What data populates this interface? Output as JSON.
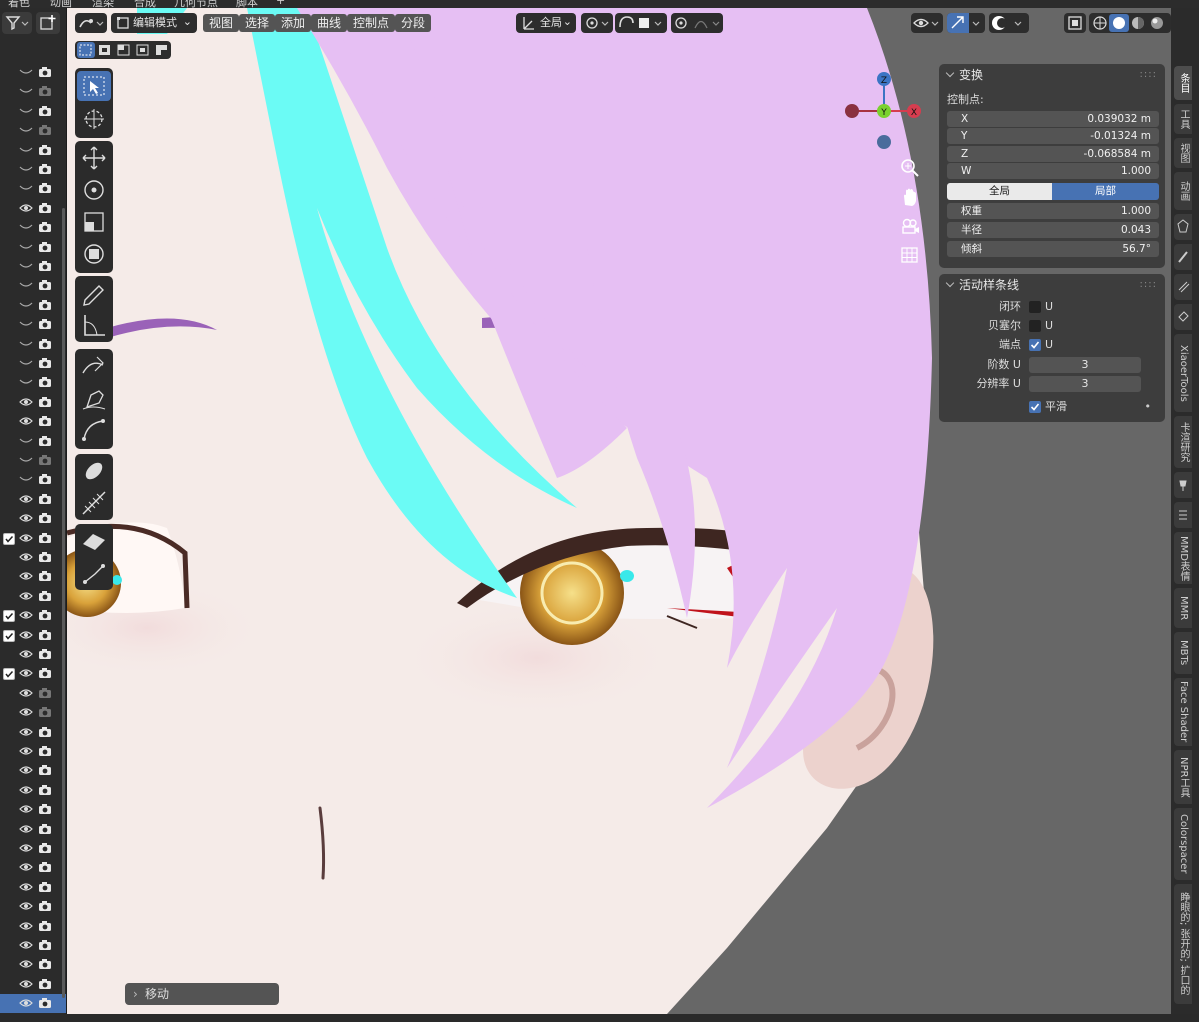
{
  "top_tabs": [
    "着色",
    "动画",
    "渲染",
    "合成",
    "几何节点",
    "脚本",
    "+"
  ],
  "header": {
    "mode": "编辑模式",
    "menus": [
      "视图",
      "选择",
      "添加",
      "曲线",
      "控制点",
      "分段"
    ],
    "orientation": "全局"
  },
  "transform_panel": {
    "title": "变换",
    "control_point_label": "控制点:",
    "fields": [
      {
        "label": "X",
        "value": "0.039032 m"
      },
      {
        "label": "Y",
        "value": "-0.01324 m"
      },
      {
        "label": "Z",
        "value": "-0.068584 m"
      },
      {
        "label": "W",
        "value": "1.000"
      }
    ],
    "space_global": "全局",
    "space_local": "局部",
    "space_active": "局部",
    "extra": [
      {
        "label": "权重",
        "value": "1.000"
      },
      {
        "label": "半径",
        "value": "0.043"
      },
      {
        "label": "倾斜",
        "value": "56.7°"
      }
    ]
  },
  "spline_panel": {
    "title": "活动样条线",
    "checks": [
      {
        "label": "闭环",
        "text": "U",
        "checked": false
      },
      {
        "label": "贝塞尔",
        "text": "U",
        "checked": false
      },
      {
        "label": "端点",
        "text": "U",
        "checked": true
      }
    ],
    "numbers": [
      {
        "label": "阶数 U",
        "value": "3"
      },
      {
        "label": "分辨率 U",
        "value": "3"
      }
    ],
    "smooth_label": "平滑",
    "smooth_checked": true
  },
  "gizmo_axes": {
    "z": "Z",
    "y": "Y",
    "x": "X"
  },
  "sidebar_tabs": [
    "条目",
    "工具",
    "视图",
    "动画",
    "XiaoerTools",
    "卡渲研究",
    "MMD表情",
    "MMR",
    "MBTs",
    "Face Shader",
    "NPR工具",
    "Colorspacer",
    "睁眼的; 张开的; 扩口的"
  ],
  "last_operator": "移动",
  "colors": {
    "accent": "#4772b3",
    "hair_pink": "#e6bff3",
    "hair_cyan": "#6bfbf5",
    "skin": "#f5ebe8",
    "viewport_bg": "#676767"
  }
}
